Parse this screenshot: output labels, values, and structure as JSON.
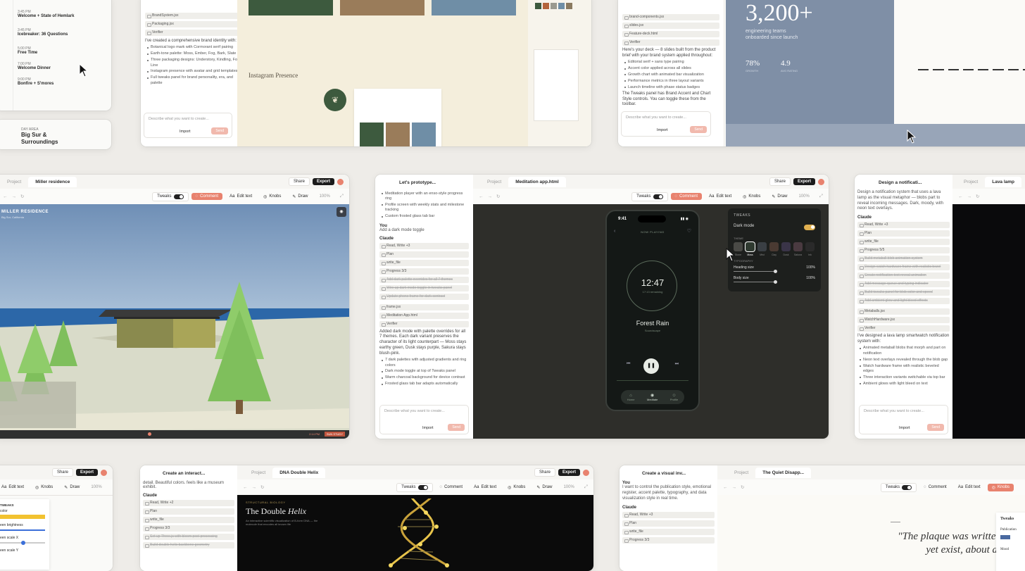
{
  "top_left": {
    "schedule": [
      {
        "time": "3:45 PM",
        "title": "Welcome + State of Hemlark"
      },
      {
        "time": "3:45 PM",
        "title": "Icebreaker: 36 Questions"
      },
      {
        "time": "5:00 PM",
        "title": "Free Time"
      },
      {
        "time": "7:00 PM",
        "title": "Welcome Dinner"
      },
      {
        "time": "9:00 PM",
        "title": "Bonfire + S'mores"
      }
    ],
    "day_label": "DAY AREA",
    "big_sur_title": "Big Sur & Surroundings"
  },
  "brand_window": {
    "files": [
      "BrandSystem.jsx",
      "Packaging.jsx"
    ],
    "verifier": "Verifier",
    "summary": "I've created a comprehensive brand identity with:",
    "bullets": [
      "Botanical logo mark with Cormorant serif pairing",
      "Earth-tone palette: Moss, Ember, Fog, Bark, Slate",
      "Three packaging designs: Understory, Kindling, Fog Line",
      "Instagram presence with avatar and grid templates",
      "Full tweaks panel for brand personality, era, and palette"
    ],
    "composer_placeholder": "Describe what you want to create...",
    "import_label": "Import",
    "send_label": "Send",
    "instagram_label": "Instagram Presence",
    "swatch_colors": [
      "#3d5a3e",
      "#9a7c5a",
      "#6f8ea6"
    ]
  },
  "deck_window": {
    "files": [
      "brand-components.jsx",
      "slides.jsx",
      "Feature-deck.html"
    ],
    "verifier": "Verifier",
    "summary": "Here's your deck — 8 slides built from the product brief with your brand system applied throughout:",
    "bullets": [
      "Editorial serif + sans type pairing",
      "Accent color applied across all slides",
      "Growth chart with animated bar visualization",
      "Performance metrics in three layout variants",
      "Launch timeline with phase status badges"
    ],
    "note": "The Tweaks panel has Brand Accent and Chart Style controls. You can toggle these from the toolbar.",
    "composer_placeholder": "Describe what you want to create...",
    "import_label": "Import",
    "send_label": "Send",
    "big_number": "3,200+",
    "big_caption": "engineering teams onboarded since launch",
    "stat1": "78%",
    "stat1_label": "GROWTH",
    "stat2": "4.9",
    "stat2_label": "AVG RATING"
  },
  "miller": {
    "tab_project": "Project",
    "tab_title": "Miller residence",
    "share": "Share",
    "export": "Export",
    "tweaks": "Tweaks",
    "comment": "Comment",
    "edit_text": "Edit text",
    "knobs": "Knobs",
    "draw": "Draw",
    "zoom": "100%",
    "scene_title": "MILLER RESIDENCE",
    "scene_sub": "Big Sur, California",
    "footer_time": "2:14 PM",
    "footer_btn": "SUN STUDY"
  },
  "meditation": {
    "chat_tab": "Let's prototype...",
    "tab_project": "Project",
    "tab_file": "Meditation app.html",
    "share": "Share",
    "export": "Export",
    "tweaks": "Tweaks",
    "comment": "Comment",
    "edit_text": "Edit text",
    "knobs": "Knobs",
    "draw": "Draw",
    "zoom": "100%",
    "intro_bullets": [
      "Meditation player with an enso-style progress ring",
      "Profile screen with weekly stats and milestone tracking",
      "Custom frosted glass tab bar"
    ],
    "you_label": "You",
    "you_msg": "Add a dark mode toggle",
    "claude_label": "Claude",
    "tools": [
      "Read, Write +3",
      "Plan",
      "write_file",
      "Progress 3/3"
    ],
    "done_tasks": [
      "Add dark palette overrides for all 7 themes",
      "Wire up dark mode toggle in tweaks panel",
      "Update phone frame for dark contrast"
    ],
    "files": [
      "frame.jsx",
      "Meditation App.html"
    ],
    "verifier": "Verifier",
    "result": "Added dark mode with palette overrides for all 7 themes. Each dark variant preserves the character of its light counterpart — Moss stays earthy green, Dusk stays purple, Sakura stays blush-pink.",
    "result_bullets": [
      "7 dark palettes with adjusted gradients and ring colors",
      "Dark mode toggle at top of Tweaks panel",
      "Warm charcoal background for device contrast",
      "Frosted glass tab bar adapts automatically"
    ],
    "composer_placeholder": "Describe what you want to create...",
    "import_label": "Import",
    "send_label": "Send",
    "phone_time": "9:41",
    "now_playing": "NOW PLAYING",
    "timer": "12:47",
    "timer_sub": "17:13 remaining",
    "track": "Forest Rain",
    "track_sub": "Soundscape",
    "nav": [
      "Home",
      "Meditate",
      "Profile"
    ],
    "tweaks_title": "TWEAKS",
    "dark_mode": "Dark mode",
    "theme_label": "THEME",
    "themes": [
      "Stone",
      "Moss",
      "Mist",
      "Clay",
      "Dusk",
      "Sakura",
      "Ink"
    ],
    "theme_colors": [
      "#4a4a46",
      "#2f3a30",
      "#3a3f44",
      "#4a3a32",
      "#3a3448",
      "#4a3a40",
      "#2a2a2a"
    ],
    "typography_label": "TYPOGRAPHY",
    "heading_size": "Heading size",
    "heading_val": "100%",
    "body_size": "Body size",
    "body_val": "100%"
  },
  "lava": {
    "chat_tab": "Design a notificati...",
    "tab_project": "Project",
    "tab_file": "Lava lamp",
    "intro": "Design a notification system that uses a lava lamp as the visual metaphor — blobs part to reveal incoming messages. Dark, moody, with neon text overlays.",
    "claude_label": "Claude",
    "tools": [
      "Read, Write +3",
      "Plan",
      "write_file",
      "Progress 5/5"
    ],
    "done_tasks": [
      "Build metaball blob animation system",
      "Design watch hardware frame with realistic bezel",
      "Create notification text reveal animation",
      "Add message queue and typing indicator",
      "Build tweaks panel for blob color and speed",
      "Add ambient glow and light bleed effects"
    ],
    "files": [
      "Metaballs.jsx",
      "WatchHardware.jsx"
    ],
    "verifier": "Verifier",
    "result": "I've designed a lava lamp smartwatch notification system with:",
    "result_bullets": [
      "Animated metaball blobs that morph and part on notification",
      "Neon text overlays revealed through the blob gap",
      "Watch hardware frame with realistic beveled edges",
      "Three interaction variants switchable via top bar",
      "Ambient glows with light bleed on text"
    ],
    "composer_placeholder": "Describe what you want to create...",
    "import_label": "Import",
    "send_label": "Send"
  },
  "bottom_left": {
    "share": "Share",
    "export": "Export",
    "edit_text": "Edit text",
    "knobs": "Knobs",
    "draw": "Draw",
    "zoom": "100%",
    "panel_title": "TWEAKS",
    "panel_rows": [
      "color",
      "een brightness",
      "een scale X",
      "een scale Y"
    ]
  },
  "helix": {
    "chat_tab": "Create an interact...",
    "tab_project": "Project",
    "tab_file": "DNA Double Helix",
    "share": "Share",
    "export": "Export",
    "tweaks": "Tweaks",
    "comment": "Comment",
    "edit_text": "Edit text",
    "knobs": "Knobs",
    "draw": "Draw",
    "zoom": "100%",
    "intro": "detail. Beautiful colors. feels like a museum exhibit.",
    "claude_label": "Claude",
    "tools": [
      "Read, Write +2",
      "Plan",
      "write_file",
      "Progress 3/3"
    ],
    "done_tasks": [
      "Set up Three.js with bloom post-processing",
      "Build double helix backbone geometry"
    ],
    "eyebrow": "STRUCTURAL BIOLOGY",
    "title_plain": "The Double ",
    "title_italic": "Helix",
    "desc": "An interactive scientific visualization of B-form DNA — the molecule that encodes all known life"
  },
  "quiet": {
    "chat_tab": "Create a visual inv...",
    "tab_project": "Project",
    "tab_file": "The Quiet Disapp...",
    "tweaks": "Tweaks",
    "comment": "Comment",
    "edit_text": "Edit text",
    "knobs": "Knobs",
    "you_label": "You",
    "you_msg": "I want to control the publication style, emotional register, accent palette, typography, and data visualization style in real time.",
    "claude_label": "Claude",
    "tools": [
      "Read, Write +3",
      "Plan",
      "write_file",
      "Progress 3/3"
    ],
    "quote": "\"The plaque was written for readers who do not yet exist, about a problem we have",
    "panel_title": "Tweaks",
    "panel_pub": "Publication",
    "panel_mood": "Mood"
  }
}
